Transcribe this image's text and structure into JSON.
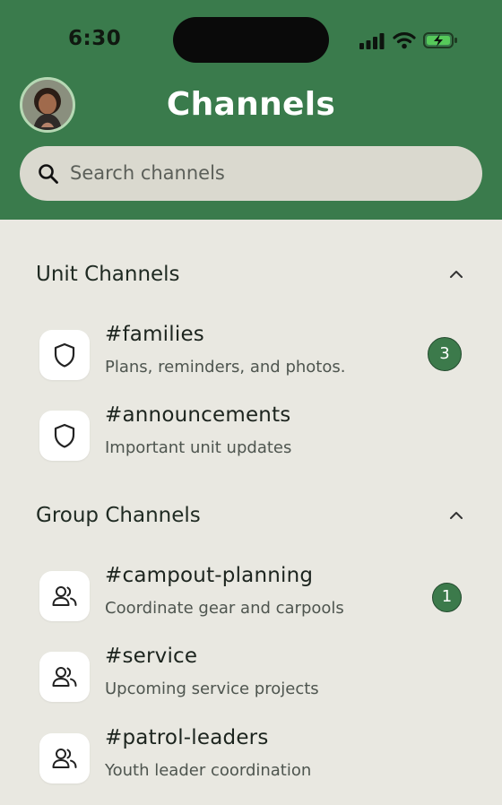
{
  "status_bar": {
    "time": "6:30"
  },
  "header": {
    "title": "Channels"
  },
  "search": {
    "placeholder": "Search channels"
  },
  "sections": [
    {
      "title": "Unit Channels",
      "channels": [
        {
          "name": "#families",
          "description": "Plans, reminders, and photos.",
          "badge": "3",
          "icon": "shield-icon"
        },
        {
          "name": "#announcements",
          "description": "Important unit updates",
          "icon": "shield-icon"
        }
      ]
    },
    {
      "title": "Group Channels",
      "channels": [
        {
          "name": "#campout-planning",
          "description": "Coordinate gear and carpools",
          "badge": "1",
          "icon": "group-icon"
        },
        {
          "name": "#service",
          "description": "Upcoming service projects",
          "icon": "group-icon"
        },
        {
          "name": "#patrol-leaders",
          "description": "Youth leader coordination",
          "icon": "group-icon"
        }
      ]
    }
  ],
  "colors": {
    "header": "#3a7b4c",
    "background": "#e9e8e1",
    "badge": "#3c7a4b"
  }
}
